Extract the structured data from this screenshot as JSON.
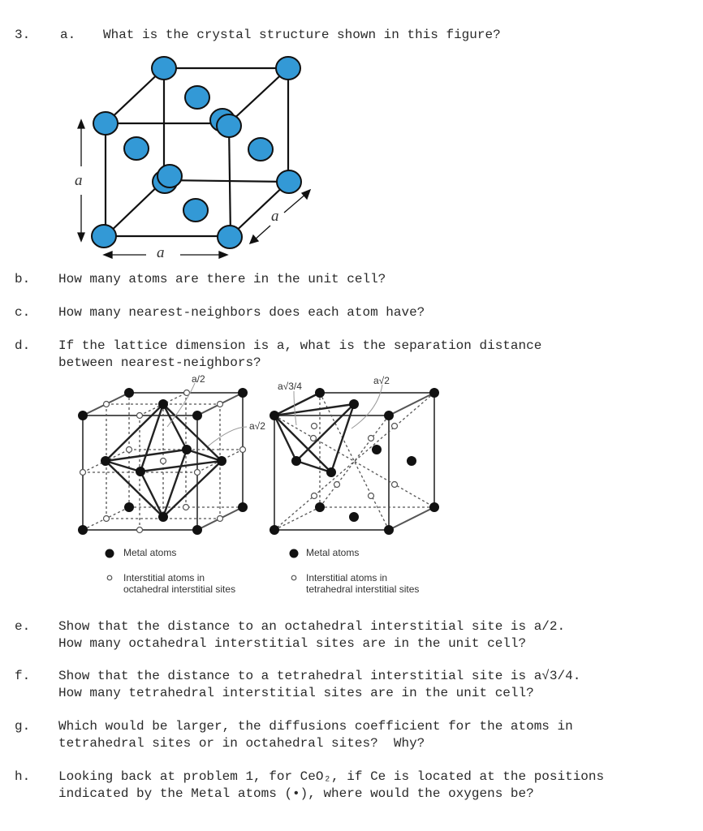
{
  "problem": {
    "number": "3.",
    "parts": [
      {
        "letter": "a.",
        "lines": [
          "What is the crystal structure shown in this figure?"
        ]
      },
      {
        "letter": "b.",
        "lines": [
          "How many atoms are there in the unit cell?"
        ]
      },
      {
        "letter": "c.",
        "lines": [
          "How many nearest-neighbors does each atom have?"
        ]
      },
      {
        "letter": "d.",
        "lines": [
          "If the lattice dimension is a, what is the separation distance",
          "between nearest-neighbors?"
        ]
      },
      {
        "letter": "e.",
        "lines": [
          "Show that the distance to an octahedral interstitial site is a/2.",
          "How many octahedral interstitial sites are in the unit cell?"
        ]
      },
      {
        "letter": "f.",
        "lines": [
          "Show that the distance to a tetrahedral interstitial site is a√3/4.",
          "How many tetrahedral interstitial sites are in the unit cell?"
        ]
      },
      {
        "letter": "g.",
        "lines": [
          "Which would be larger, the diffusions coefficient for the atoms in",
          "tetrahedral sites or in octahedral sites?  Why?"
        ]
      },
      {
        "letter": "h.",
        "lines": [
          "Looking back at problem 1, for CeO₂, if Ce is located at the positions",
          "indicated by the Metal atoms (•), where would the oxygens be?"
        ]
      }
    ]
  },
  "fcc_figure": {
    "label_vertical": "a",
    "label_horizontal": "a",
    "label_depth": "a",
    "atom_color": "#3399d6"
  },
  "octahedral_figure": {
    "label_top": "a/2",
    "label_side": "a√2",
    "legend": [
      {
        "symbol": "filled-dot",
        "text": "Metal atoms"
      },
      {
        "symbol": "open-dot",
        "text_lines": [
          "Interstitial atoms in",
          "octahedral interstitial sites"
        ]
      }
    ]
  },
  "tetrahedral_figure": {
    "label_left": "a√3/4",
    "label_right": "a√2",
    "legend": [
      {
        "symbol": "filled-dot",
        "text": "Metal atoms"
      },
      {
        "symbol": "open-dot",
        "text_lines": [
          "Interstitial atoms in",
          "tetrahedral interstitial sites"
        ]
      }
    ]
  }
}
